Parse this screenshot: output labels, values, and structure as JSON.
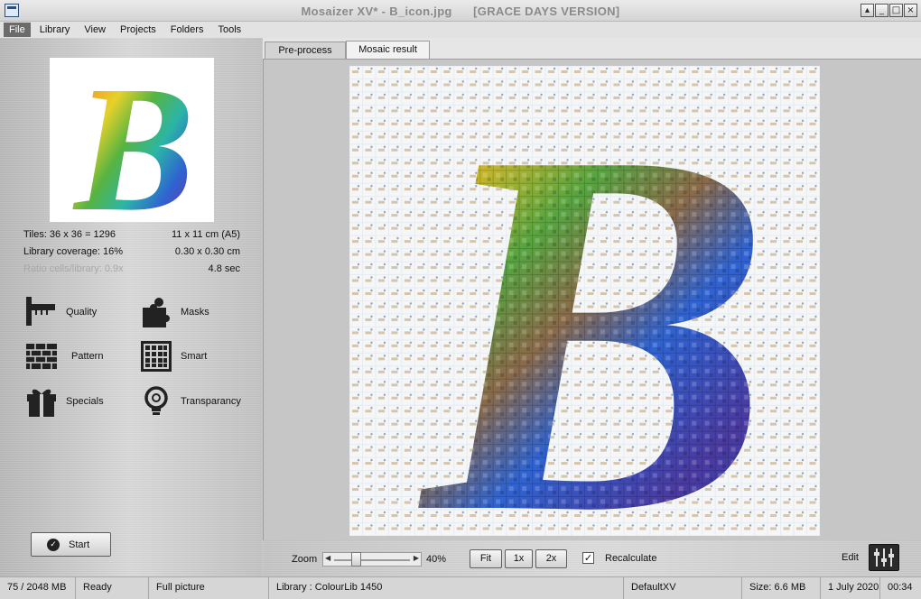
{
  "window": {
    "title": "Mosaizer XV* - B_icon.jpg",
    "title_suffix": "[GRACE DAYS VERSION]",
    "buttons": [
      "▴",
      "_",
      "□",
      "×"
    ]
  },
  "menu": [
    "File",
    "Library",
    "View",
    "Projects",
    "Folders",
    "Tools"
  ],
  "info": {
    "tiles": "Tiles: 36 x 36 = 1296",
    "size": "11 x 11 cm  (A5)",
    "coverage": "Library coverage: 16%",
    "cell_size": "0.30 x 0.30 cm",
    "ratio": "Ratio cells/library: 0.9x",
    "time": "4.8 sec"
  },
  "preview_letter": "B",
  "tools": [
    {
      "label": "Quality",
      "icon": "quality-icon"
    },
    {
      "label": "Masks",
      "icon": "puzzle-icon"
    },
    {
      "label": "Pattern",
      "icon": "brick-icon"
    },
    {
      "label": "Smart",
      "icon": "grid-icon"
    },
    {
      "label": "Specials",
      "icon": "gift-icon"
    },
    {
      "label": "Transparancy",
      "icon": "bulb-icon"
    }
  ],
  "start_label": "Start",
  "tabs": [
    "Pre-process",
    "Mosaic result"
  ],
  "active_tab": 1,
  "zoom": {
    "label": "Zoom",
    "value": "40%",
    "slider_fraction": 0.25
  },
  "zoom_buttons": [
    "Fit",
    "1x",
    "2x"
  ],
  "recalculate": {
    "label": "Recalculate",
    "checked": true
  },
  "edit_label": "Edit",
  "status": {
    "memory": "75 / 2048 MB",
    "state": "Ready",
    "view": "Full picture",
    "library": "Library  : ColourLib 1450",
    "profile": "DefaultXV",
    "filesize": "Size: 6.6 MB",
    "date": "1 July 2020",
    "time": "00:34"
  },
  "colors": {
    "rainbow": [
      "#e83b2f",
      "#f39a26",
      "#e6d12a",
      "#57b441",
      "#2bb5a6",
      "#2f63d1",
      "#6a37a8",
      "#b52e86"
    ]
  }
}
